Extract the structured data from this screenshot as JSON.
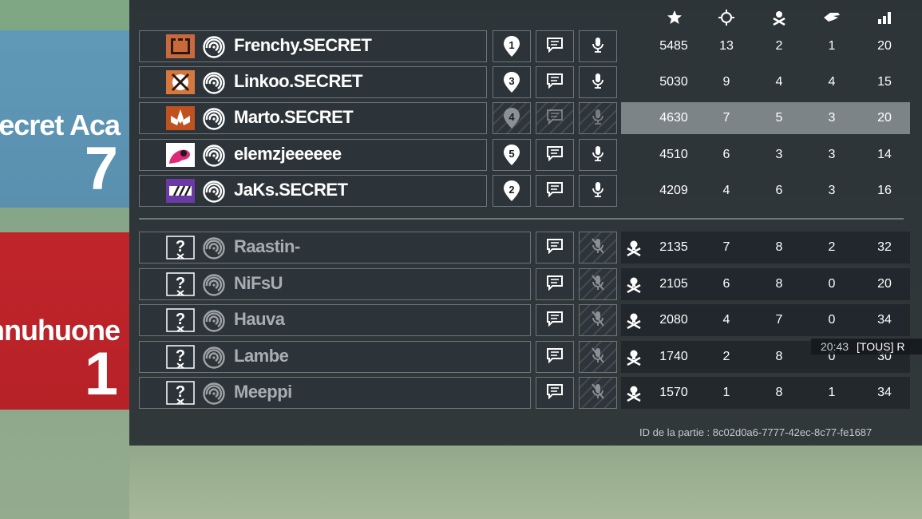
{
  "colors": {
    "ally": "#5a93b2",
    "enemy": "#bd242b",
    "panel": "#262c32"
  },
  "stat_headers": [
    {
      "icon": "score-star-icon"
    },
    {
      "icon": "kills-crosshair-icon"
    },
    {
      "icon": "deaths-skull-icon"
    },
    {
      "icon": "assists-hands-icon"
    },
    {
      "icon": "ping-bars-icon"
    }
  ],
  "ally_team": {
    "name": "Secret Aca",
    "score": "7",
    "players": [
      {
        "name": "Frenchy.SECRET",
        "operator": "castle-operator-icon",
        "ping_marker": "1",
        "score": "5485",
        "kills": "13",
        "deaths": "2",
        "assists": "1",
        "ping": "20"
      },
      {
        "name": "Linkoo.SECRET",
        "operator": "fuze-operator-icon",
        "ping_marker": "3",
        "score": "5030",
        "kills": "9",
        "deaths": "4",
        "assists": "4",
        "ping": "15"
      },
      {
        "name": "Marto.SECRET",
        "operator": "lotus-operator-icon",
        "ping_marker": "4",
        "score": "4630",
        "kills": "7",
        "deaths": "5",
        "assists": "3",
        "ping": "20"
      },
      {
        "name": "elemzjeeeeee",
        "operator": "pink-operator-icon",
        "ping_marker": "5",
        "score": "4510",
        "kills": "6",
        "deaths": "3",
        "assists": "3",
        "ping": "14"
      },
      {
        "name": "JaKs.SECRET",
        "operator": "purple-operator-icon",
        "ping_marker": "2",
        "score": "4209",
        "kills": "4",
        "deaths": "6",
        "assists": "3",
        "ping": "16"
      }
    ]
  },
  "enemy_team": {
    "name": "nnuhuone",
    "score": "1",
    "players": [
      {
        "name": "Raastin-",
        "score": "2135",
        "kills": "7",
        "deaths": "8",
        "assists": "2",
        "ping": "32"
      },
      {
        "name": "NiFsU",
        "score": "2105",
        "kills": "6",
        "deaths": "8",
        "assists": "0",
        "ping": "20"
      },
      {
        "name": "Hauva",
        "score": "2080",
        "kills": "4",
        "deaths": "7",
        "assists": "0",
        "ping": "34"
      },
      {
        "name": "Lambe",
        "score": "1740",
        "kills": "2",
        "deaths": "8",
        "assists": "0",
        "ping": "30"
      },
      {
        "name": "Meeppi",
        "score": "1570",
        "kills": "1",
        "deaths": "8",
        "assists": "1",
        "ping": "34"
      }
    ]
  },
  "chat": {
    "time": "20:43",
    "message": "[TOUS] R"
  },
  "match_id": "ID de la partie : 8c02d0a6-7777-42ec-8c77-fe1687"
}
